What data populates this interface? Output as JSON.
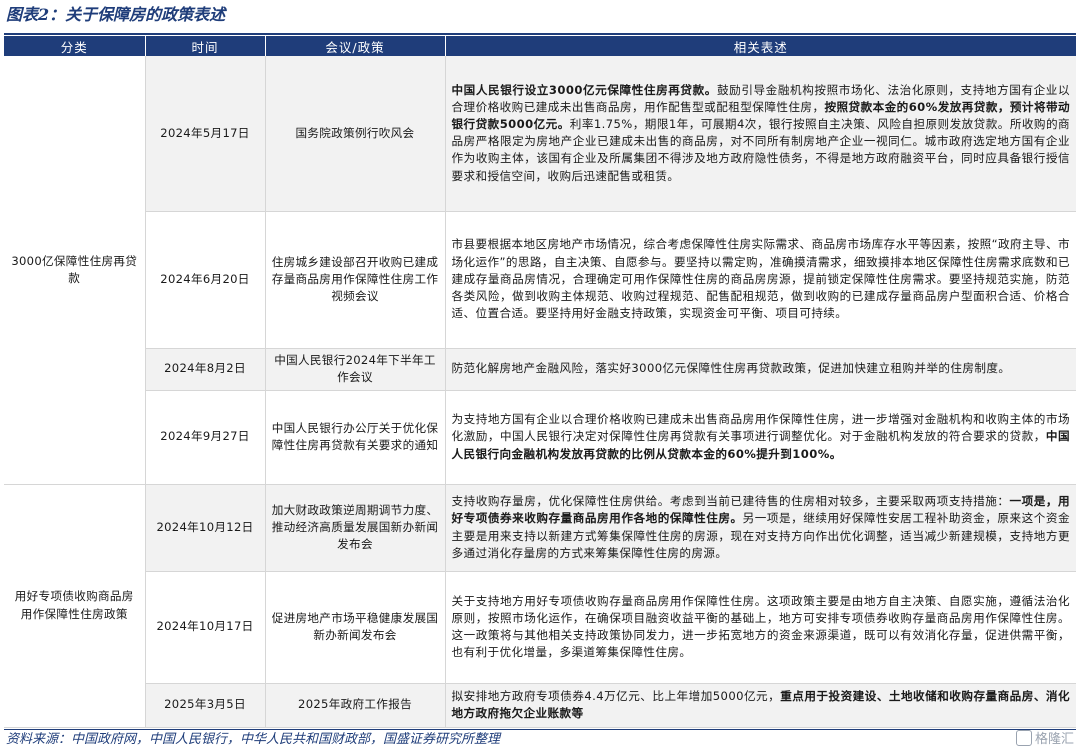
{
  "title": "图表2：关于保障房的政策表述",
  "headers": [
    "分类",
    "时间",
    "会议/政策",
    "相关表述"
  ],
  "rows": [
    {
      "time": "2024年5月17日",
      "meeting": "国务院政策例行吹风会",
      "segments": [
        {
          "t": "中国人民银行设立3000亿元保障性住房再贷款。",
          "b": true
        },
        {
          "t": "鼓励引导金融机构按照市场化、法治化原则，支持地方国有企业以合理价格收购已建成未出售商品房，用作配售型或配租型保障性住房，",
          "b": false
        },
        {
          "t": "按照贷款本金的60%发放再贷款，预计将带动银行贷款5000亿元。",
          "b": true
        },
        {
          "t": "利率1.75%，期限1年，可展期4次，银行按照自主决策、风险自担原则发放贷款。所收购的商品房严格限定为房地产企业已建成未出售的商品房，对不同所有制房地产企业一视同仁。城市政府选定地方国有企业作为收购主体，该国有企业及所属集团不得涉及地方政府隐性债务，不得是地方政府融资平台，同时应具备银行授信要求和授信空间，收购后迅速配售或租赁。",
          "b": false
        }
      ]
    },
    {
      "time": "2024年6月20日",
      "meeting": "住房城乡建设部召开收购已建成存量商品房用作保障性住房工作视频会议",
      "segments": [
        {
          "t": "市县要根据本地区房地产市场情况，综合考虑保障性住房实际需求、商品房市场库存水平等因素，按照“政府主导、市场化运作”的思路，自主决策、自愿参与。要坚持以需定购，准确摸清需求，细致摸排本地区保障性住房需求底数和已建成存量商品房情况，合理确定可用作保障性住房的商品房房源，提前锁定保障性住房需求。要坚持规范实施，防范各类风险，做到收购主体规范、收购过程规范、配售配租规范，做到收购的已建成存量商品房户型面积合适、价格合适、位置合适。要坚持用好金融支持政策，实现资金可平衡、项目可持续。",
          "b": false
        }
      ]
    },
    {
      "time": "2024年8月2日",
      "meeting": "中国人民银行2024年下半年工作会议",
      "segments": [
        {
          "t": "防范化解房地产金融风险，落实好3000亿元保障性住房再贷款政策，促进加快建立租购并举的住房制度。",
          "b": false
        }
      ]
    },
    {
      "time": "2024年9月27日",
      "meeting": "中国人民银行办公厅关于优化保障性住房再贷款有关要求的通知",
      "segments": [
        {
          "t": "为支持地方国有企业以合理价格收购已建成未出售商品房用作保障性住房，进一步增强对金融机构和收购主体的市场化激励，中国人民银行决定对保障性住房再贷款有关事项进行调整优化。对于金融机构发放的符合要求的贷款，",
          "b": false
        },
        {
          "t": "中国人民银行向金融机构发放再贷款的比例从贷款本金的60%提升到100%。",
          "b": true
        }
      ]
    },
    {
      "time": "2024年10月12日",
      "meeting": "加大财政政策逆周期调节力度、推动经济高质量发展国新办新闻发布会",
      "segments": [
        {
          "t": "支持收购存量房，优化保障性住房供给。考虑到当前已建待售的住房相对较多，主要采取两项支持措施：",
          "b": false
        },
        {
          "t": "一项是，用好专项债券来收购存量商品房用作各地的保障性住房。",
          "b": true
        },
        {
          "t": "另一项是，继续用好保障性安居工程补助资金，原来这个资金主要是用来支持以新建方式筹集保障性住房的房源，现在对支持方向作出优化调整，适当减少新建规模，支持地方更多通过消化存量房的方式来筹集保障性住房的房源。",
          "b": false
        }
      ]
    },
    {
      "time": "2024年10月17日",
      "meeting": "促进房地产市场平稳健康发展国新办新闻发布会",
      "segments": [
        {
          "t": "关于支持地方用好专项债收购存量商品房用作保障性住房。这项政策主要是由地方自主决策、自愿实施，遵循法治化原则，按照市场化运作，在确保项目融资收益平衡的基础上，地方可安排专项债券收购存量商品房用作保障性住房。这一政策将与其他相关支持政策协同发力，进一步拓宽地方的资金来源渠道，既可以有效消化存量，促进供需平衡，也有利于优化增量，多渠道筹集保障性住房。",
          "b": false
        }
      ]
    },
    {
      "time": "2025年3月5日",
      "meeting": "2025年政府工作报告",
      "segments": [
        {
          "t": "拟安排地方政府专项债券4.4万亿元、比上年增加5000亿元，",
          "b": false
        },
        {
          "t": "重点用于投资建设、土地收储和收购存量商品房、消化地方政府拖欠企业账款等",
          "b": true
        }
      ]
    }
  ],
  "categories": [
    "3000亿保障性住房再贷款",
    "用好专项债收购商品房用作保障性住房政策"
  ],
  "source": "资料来源：中国政府网，中国人民银行，中华人民共和国财政部，国盛证券研究所整理",
  "watermark": "格隆汇",
  "colors": {
    "header_bg": "#1f3d7a",
    "shade_bg": "#f2f2f2",
    "text": "#1a1a1a"
  }
}
